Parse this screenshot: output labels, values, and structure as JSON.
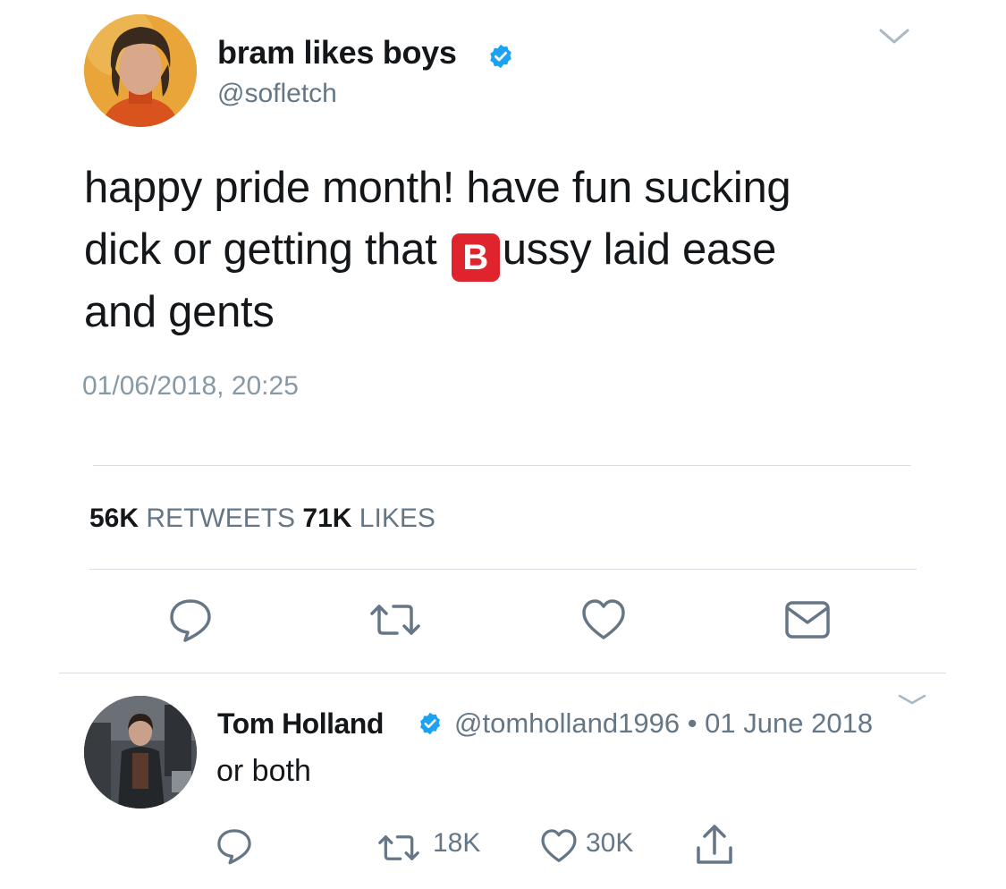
{
  "main_tweet": {
    "display_name": "bram likes boys",
    "handle": "@sofletch",
    "text_line1": "happy pride month! have fun sucking",
    "text_line2_before": "dick or getting that ",
    "emoji_letter": "B",
    "text_line2_after": "ussy laid ease",
    "text_line3": "and gents",
    "timestamp": "01/06/2018, 20:25",
    "retweets_count": "56K",
    "retweets_label": "RETWEETS",
    "likes_count": "71K",
    "likes_label": "LIKES"
  },
  "reply_tweet": {
    "display_name": "Tom Holland",
    "handle_date": "@tomholland1996 • 01 June 2018",
    "text": "or both",
    "retweets": "18K",
    "likes": "30K"
  },
  "colors": {
    "verified": "#1da1f2",
    "icon_gray": "#657786",
    "emoji_red": "#e0242e"
  },
  "icons": [
    "chevron-down-icon",
    "verified-icon",
    "reply-icon",
    "retweet-icon",
    "like-icon",
    "message-icon",
    "share-icon"
  ]
}
